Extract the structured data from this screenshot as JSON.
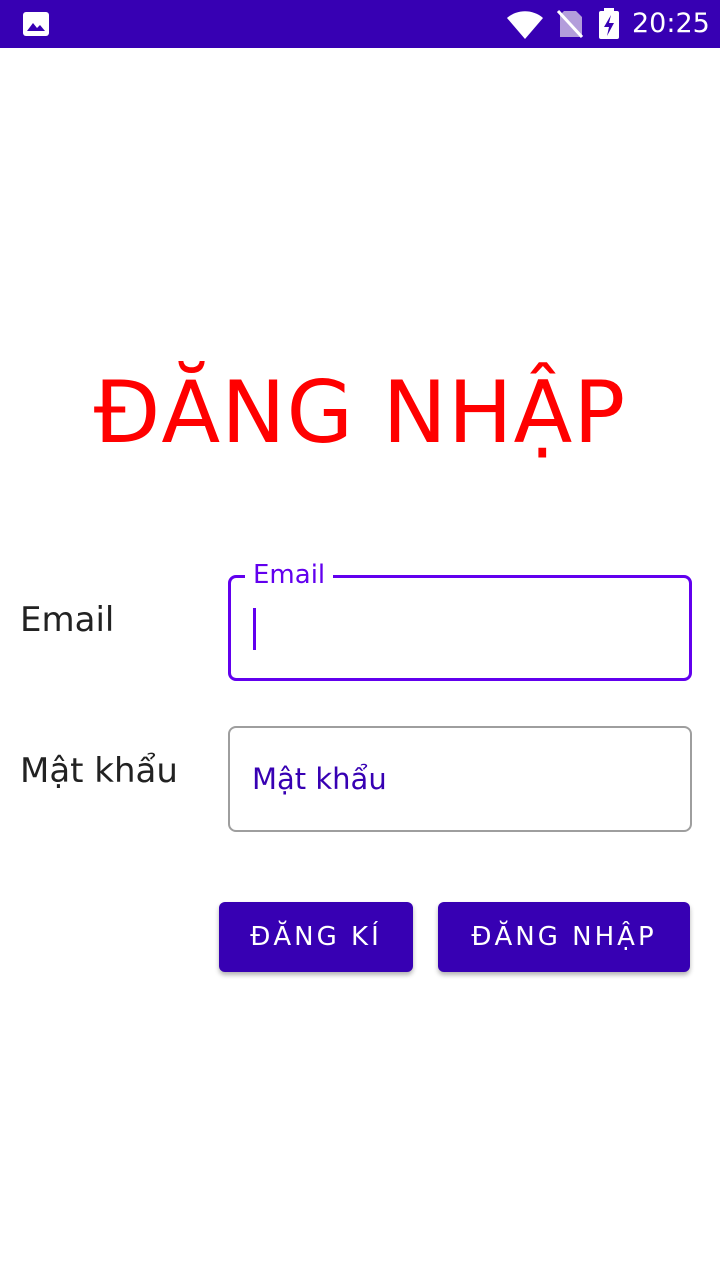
{
  "status_bar": {
    "time": "20:25",
    "background": "#3700B3",
    "icons": [
      "gallery-icon",
      "wifi-icon",
      "no-sim-icon",
      "battery-charging-icon"
    ]
  },
  "form": {
    "title": "ĐĂNG NHẬP",
    "title_color": "#FF0000",
    "email": {
      "label": "Email",
      "floating_label": "Email",
      "value": "",
      "focused": true
    },
    "password": {
      "label": "Mật khẩu",
      "placeholder": "Mật khẩu",
      "value": ""
    },
    "buttons": {
      "register": "ĐĂNG KÍ",
      "login": "ĐĂNG NHẬP"
    },
    "accent_color": "#6200EE",
    "button_color": "#3700B3"
  }
}
